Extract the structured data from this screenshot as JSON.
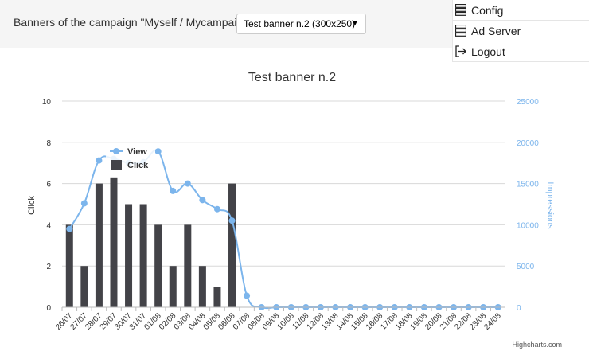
{
  "header": {
    "campaign_label": "Banners of the campaign \"Myself / Mycampaign\":",
    "banner_select_value": "Test banner n.2 (300x250)"
  },
  "menu": {
    "items": [
      {
        "label": "Config",
        "icon": "server-stack-icon"
      },
      {
        "label": "Ad Server",
        "icon": "server-stack-icon"
      },
      {
        "label": "Logout",
        "icon": "logout-icon"
      }
    ]
  },
  "chart_data": {
    "type": "bar",
    "title": "Test banner n.2",
    "categories": [
      "26/07",
      "27/07",
      "28/07",
      "29/07",
      "30/07",
      "31/07",
      "01/08",
      "02/08",
      "03/08",
      "04/08",
      "05/08",
      "06/08",
      "07/08",
      "08/08",
      "09/08",
      "10/08",
      "11/08",
      "12/08",
      "13/08",
      "14/08",
      "15/08",
      "16/08",
      "17/08",
      "18/08",
      "19/08",
      "20/08",
      "21/08",
      "22/08",
      "23/08",
      "24/08"
    ],
    "series": [
      {
        "name": "Click",
        "type": "column",
        "axis": "left",
        "color": "#434348",
        "values": [
          4,
          2,
          6,
          6.3,
          5,
          5,
          4,
          2,
          4,
          2,
          1,
          6,
          0,
          0,
          0,
          0,
          0,
          0,
          0,
          0,
          0,
          0,
          0,
          0,
          0,
          0,
          0,
          0,
          0,
          0
        ]
      },
      {
        "name": "View",
        "type": "spline",
        "axis": "right",
        "color": "#7cb5ec",
        "values": [
          9500,
          12600,
          17800,
          18000,
          17500,
          17600,
          18900,
          14100,
          15000,
          13000,
          11900,
          10500,
          1400,
          0,
          0,
          0,
          0,
          0,
          0,
          0,
          0,
          0,
          0,
          0,
          0,
          0,
          0,
          0,
          0,
          0
        ]
      }
    ],
    "ylabel": "Click",
    "ylim": [
      0,
      10
    ],
    "yticks": [
      "0",
      "2",
      "4",
      "6",
      "8",
      "10"
    ],
    "y2label": "Impressions",
    "y2lim": [
      0,
      25000
    ],
    "y2ticks": [
      "0",
      "5000",
      "10000",
      "15000",
      "20000",
      "25000"
    ],
    "legend": {
      "placement": "top-left",
      "items": [
        {
          "label": "View",
          "color": "#7cb5ec"
        },
        {
          "label": "Click",
          "color": "#434348"
        }
      ]
    },
    "credits": "Highcharts.com",
    "grid": true
  }
}
